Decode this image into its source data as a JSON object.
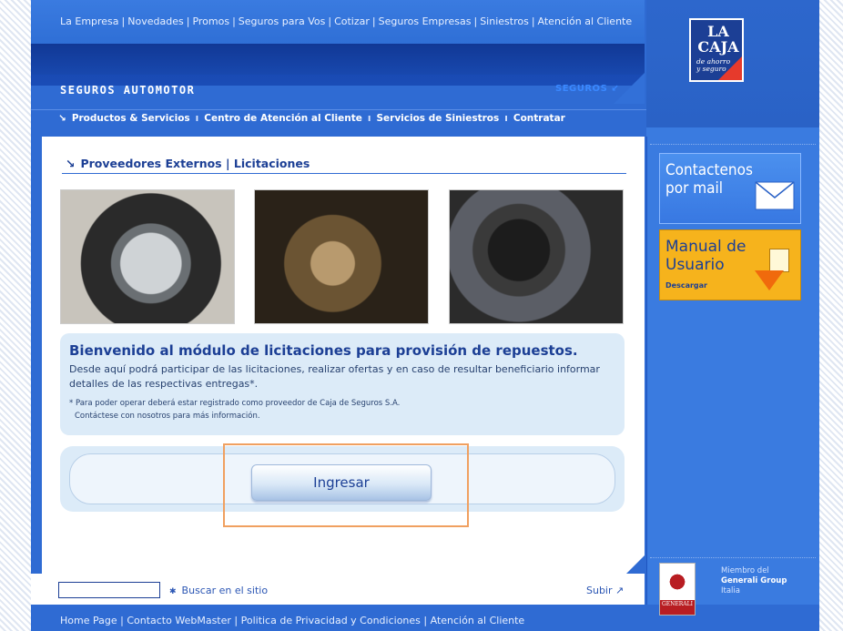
{
  "top_nav": {
    "links": [
      "La Empresa",
      "Novedades",
      "Promos",
      "Seguros para Vos",
      "Cotizar",
      "Seguros Empresas",
      "Siniestros",
      "Atención al Cliente"
    ]
  },
  "section": {
    "title": "SEGUROS AUTOMOTOR",
    "tag": "SEGUROS"
  },
  "logo": {
    "line1": "LA",
    "line2": "CAJA",
    "line3": "de ahorro",
    "line4": "y seguro"
  },
  "main_nav": {
    "items": [
      "Productos & Servicios",
      "Centro de Atención al Cliente",
      "Servicios de Siniestros",
      "Contratar"
    ]
  },
  "page": {
    "heading": "Proveedores Externos | Licitaciones",
    "welcome_title": "Bienvenido al módulo de licitaciones para provisión de repuestos.",
    "welcome_text": "Desde aquí podrá participar de las licitaciones, realizar ofertas y en caso de resultar beneficiario informar detalles de las respectivas entregas*.",
    "note_line1": "* Para poder operar deberá estar registrado como proveedor de Caja de Seguros S.A.",
    "note_line2": "Contáctese con nosotros para más información.",
    "ingresar_label": "Ingresar"
  },
  "search": {
    "value": "",
    "label": "Buscar en el sitio",
    "subir": "Subir"
  },
  "sidebar": {
    "contact_line1": "Contactenos",
    "contact_line2": "por mail",
    "manual_line1": "Manual de",
    "manual_line2": "Usuario",
    "manual_download": "Descargar",
    "member_line1": "Miembro del",
    "member_line2": "Generali Group",
    "member_line3": "Italia",
    "generali_badge": "GENERALI"
  },
  "footer": {
    "links": [
      "Home Page",
      "Contacto WebMaster",
      "Politica de Privacidad y Condiciones",
      "Atención al Cliente"
    ]
  },
  "colors": {
    "brand_blue": "#2f6bd3",
    "dark_blue": "#1c3f95",
    "accent_orange": "#f6b31c",
    "highlight": "#f0a060"
  }
}
